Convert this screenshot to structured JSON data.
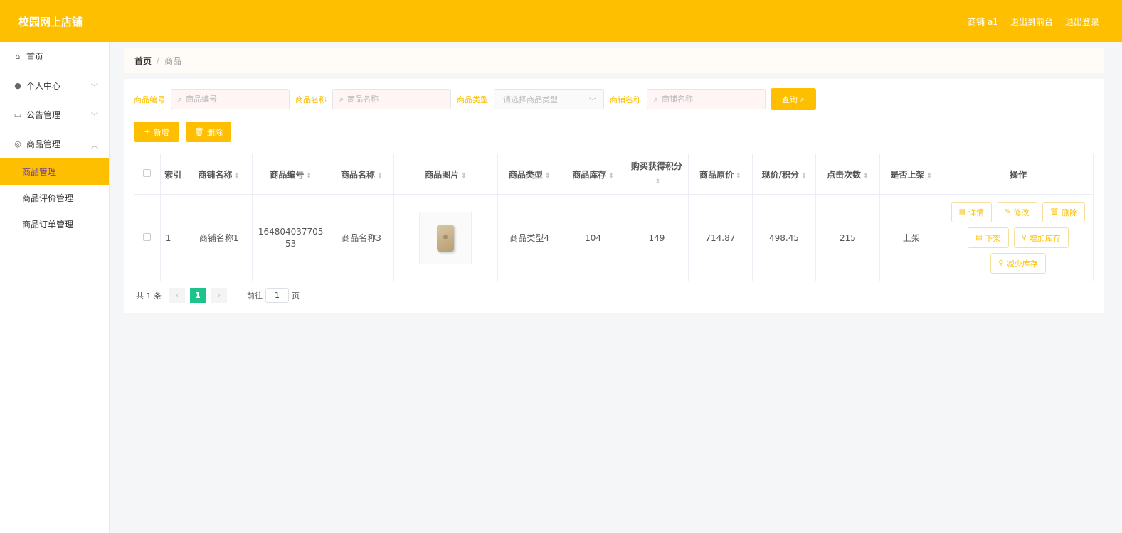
{
  "header": {
    "brand": "校园网上店铺",
    "links": [
      "商铺 a1",
      "退出到前台",
      "退出登录"
    ]
  },
  "sidebar": {
    "items": [
      {
        "label": "首页",
        "icon": "home-icon"
      },
      {
        "label": "个人中心",
        "icon": "user-icon"
      },
      {
        "label": "公告管理",
        "icon": "notice-icon"
      },
      {
        "label": "商品管理",
        "icon": "compass-icon"
      }
    ],
    "sub_items": [
      "商品管理",
      "商品评价管理",
      "商品订单管理"
    ]
  },
  "breadcrumb": {
    "home": "首页",
    "sep": "/",
    "current": "商品"
  },
  "filters": {
    "code_label": "商品编号",
    "code_placeholder": "商品编号",
    "name_label": "商品名称",
    "name_placeholder": "商品名称",
    "type_label": "商品类型",
    "type_placeholder": "请选择商品类型",
    "shop_label": "商铺名称",
    "shop_placeholder": "商铺名称",
    "query_label": "查询"
  },
  "actions": {
    "add_label": "新增",
    "delete_label": "删除"
  },
  "table": {
    "headers": [
      "索引",
      "商铺名称",
      "商品编号",
      "商品名称",
      "商品图片",
      "商品类型",
      "商品库存",
      "购买获得积分",
      "商品原价",
      "现价/积分",
      "点击次数",
      "是否上架",
      "操作"
    ],
    "rows": [
      {
        "index": "1",
        "shop_name": "商铺名称1",
        "code": "164804037705 53",
        "name": "商品名称3",
        "type": "商品类型4",
        "stock": "104",
        "points": "149",
        "original_price": "714.87",
        "current_price": "498.45",
        "clicks": "215",
        "on_shelf": "上架",
        "ops": [
          "详情",
          "修改",
          "删除",
          "下架",
          "增加库存",
          "减少库存"
        ]
      }
    ]
  },
  "pager": {
    "total": "共 1 条",
    "current": "1",
    "goto": "前往",
    "goto_value": "1",
    "page_unit": "页"
  }
}
